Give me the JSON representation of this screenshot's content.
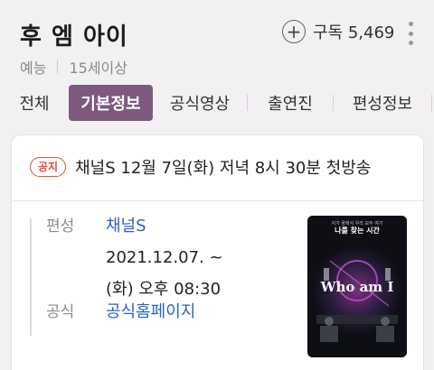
{
  "show": {
    "title": "후 엠 아이",
    "genre": "예능",
    "rating": "15세이상",
    "subscribe_count": "구독 5,469"
  },
  "tabs": [
    {
      "label": "전체"
    },
    {
      "label": "기본정보",
      "active": true
    },
    {
      "label": "공식영상"
    },
    {
      "label": "출연진"
    },
    {
      "label": "편성정보"
    }
  ],
  "notice": {
    "badge": "공지",
    "text": "채널S 12월 7일(화) 저녁 8시 30분 첫방송"
  },
  "info": {
    "broadcast_label": "편성",
    "broadcast_channel": "채널S",
    "broadcast_date": "2021.12.07. ~",
    "broadcast_time": "(화) 오후 08:30",
    "official_label": "공식",
    "official_link": "공식홈페이지"
  },
  "poster": {
    "title": "Who am I",
    "tagline": "나를 찾는 시간"
  },
  "colors": {
    "accent": "#7b5a7e",
    "link": "#2a63c6",
    "notice": "#e24b3b"
  }
}
